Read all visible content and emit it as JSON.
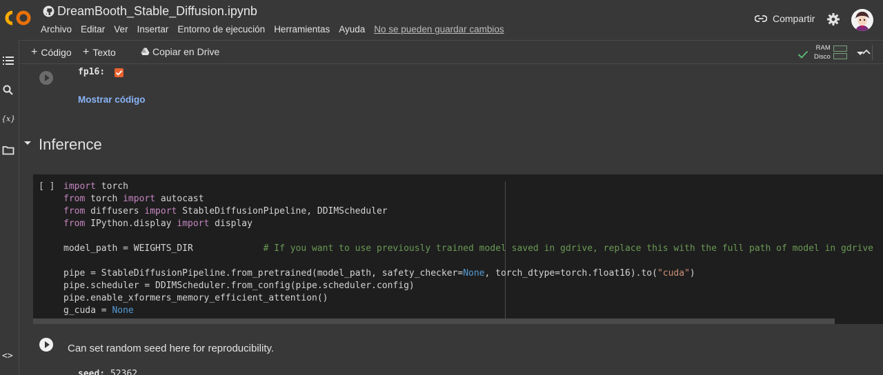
{
  "header": {
    "title": "DreamBooth_Stable_Diffusion.ipynb",
    "menu": [
      "Archivo",
      "Editar",
      "Ver",
      "Insertar",
      "Entorno de ejecución",
      "Herramientas",
      "Ayuda"
    ],
    "unsaved_notice": "No se pueden guardar cambios",
    "share_label": "Compartir",
    "icons": {
      "logo": "colab-logo",
      "title": "github-icon",
      "share": "link-icon",
      "settings": "gear-icon",
      "user": "avatar"
    }
  },
  "toolbar": {
    "add_code": "Código",
    "add_text": "Texto",
    "copy_drive": "Copiar en Drive",
    "ram_label": "RAM",
    "disk_label": "Disco"
  },
  "sidebar": {
    "icons": [
      "toc-icon",
      "search-icon",
      "variables-icon",
      "folder-icon",
      "code-snippets-icon"
    ],
    "variables_glyph": "{x}",
    "code_glyph": "<>"
  },
  "cells": {
    "fp16_label": "fp16:",
    "fp16_checked": true,
    "show_code": "Mostrar código",
    "section_title": "Inference",
    "bracket": "[ ]",
    "code_lines": [
      [
        {
          "t": "import",
          "c": "kw"
        },
        {
          "t": " torch",
          "c": ""
        }
      ],
      [
        {
          "t": "from",
          "c": "kw"
        },
        {
          "t": " torch ",
          "c": ""
        },
        {
          "t": "import",
          "c": "kw"
        },
        {
          "t": " autocast",
          "c": ""
        }
      ],
      [
        {
          "t": "from",
          "c": "kw"
        },
        {
          "t": " diffusers ",
          "c": ""
        },
        {
          "t": "import",
          "c": "kw"
        },
        {
          "t": " StableDiffusionPipeline, DDIMScheduler",
          "c": ""
        }
      ],
      [
        {
          "t": "from",
          "c": "kw"
        },
        {
          "t": " IPython.display ",
          "c": ""
        },
        {
          "t": "import",
          "c": "kw"
        },
        {
          "t": " display",
          "c": ""
        }
      ],
      [
        {
          "t": "",
          "c": ""
        }
      ],
      [
        {
          "t": "model_path = WEIGHTS_DIR             ",
          "c": ""
        },
        {
          "t": "# If you want to use previously trained model saved in gdrive, replace this with the full path of model in gdrive",
          "c": "cmt"
        }
      ],
      [
        {
          "t": "",
          "c": ""
        }
      ],
      [
        {
          "t": "pipe = StableDiffusionPipeline.from_pretrained(model_path, safety_checker=",
          "c": ""
        },
        {
          "t": "None",
          "c": "none"
        },
        {
          "t": ", torch_dtype=torch.float16).to(",
          "c": ""
        },
        {
          "t": "\"cuda\"",
          "c": "str"
        },
        {
          "t": ")",
          "c": ""
        }
      ],
      [
        {
          "t": "pipe.scheduler = DDIMScheduler.from_config(pipe.scheduler.config)",
          "c": ""
        }
      ],
      [
        {
          "t": "pipe.enable_xformers_memory_efficient_attention()",
          "c": ""
        }
      ],
      [
        {
          "t": "g_cuda = ",
          "c": ""
        },
        {
          "t": "None",
          "c": "none"
        }
      ]
    ],
    "text_cell": "Can set random seed here for reproducibility.",
    "seed_label": "seed:",
    "seed_value": "52362"
  }
}
